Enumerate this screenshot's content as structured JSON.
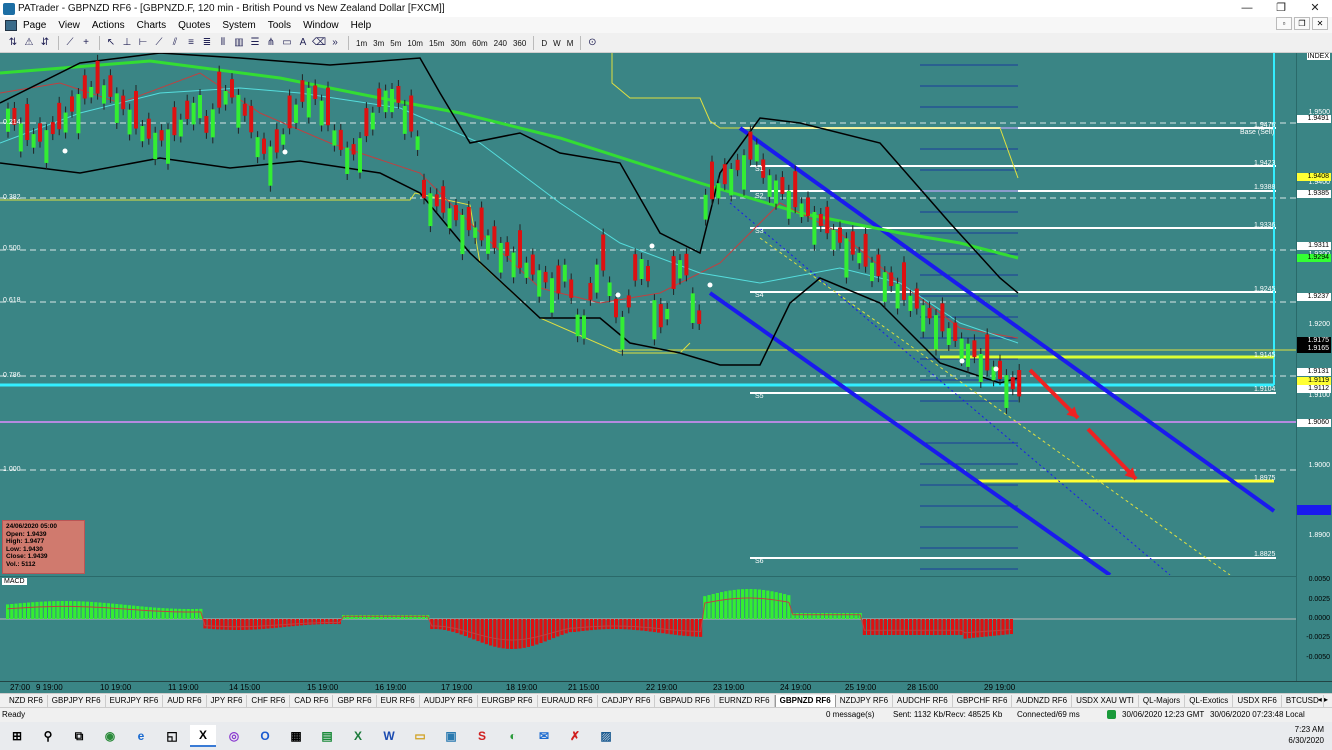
{
  "window": {
    "title": "PATrader - GBPNZD RF6 - [GBPNZD.F, 120 min - British Pound vs New Zealand Dollar [FXCM]]",
    "controls": [
      "—",
      "❐",
      "✕"
    ]
  },
  "menu": {
    "items": [
      "Page",
      "View",
      "Actions",
      "Charts",
      "Quotes",
      "System",
      "Tools",
      "Window",
      "Help"
    ],
    "mdi_controls": [
      "▫",
      "❐",
      "✕"
    ]
  },
  "toolbar": {
    "timeframes": [
      "1m",
      "3m",
      "5m",
      "10m",
      "15m",
      "30m",
      "60m",
      "240",
      "360"
    ],
    "periods": [
      "D",
      "W",
      "M"
    ]
  },
  "chart": {
    "symbol": "GBPNZD.F",
    "interval": "120 min",
    "index_label": "INDEX",
    "price_labels": [
      "1.9500",
      "1.9400",
      "1.9300",
      "1.9200",
      "1.9100",
      "1.9000",
      "1.8900",
      "1.8800"
    ],
    "price_tags": [
      {
        "text": "1.9491",
        "color": "#ffffff"
      },
      {
        "text": "1.9408",
        "color": "#ffff33"
      },
      {
        "text": "1.9385",
        "color": "#ffffff"
      },
      {
        "text": "1.9311",
        "color": "#ffffff"
      },
      {
        "text": "1.9294",
        "color": "#33ff33"
      },
      {
        "text": "1.9237",
        "color": "#ffffff"
      },
      {
        "text": "1.9175",
        "color": "#000000"
      },
      {
        "text": "1.9165",
        "color": "#000000"
      },
      {
        "text": "1.9131",
        "color": "#ffffff"
      },
      {
        "text": "1.9119",
        "color": "#ffff33"
      },
      {
        "text": "1.9112",
        "color": "#ffffff"
      },
      {
        "text": "1.9060",
        "color": "#ffffff"
      }
    ],
    "fib_levels": [
      "0.214",
      "0.382",
      "0.500",
      "0.618",
      "0.786",
      "1.000"
    ],
    "pivot_labels": [
      {
        "level": "1.9476",
        "tag": "Base (Sell)"
      },
      {
        "level": "1.9423",
        "tag": "S1"
      },
      {
        "level": "1.9388",
        "tag": "S2"
      },
      {
        "level": "1.9336",
        "tag": "S3"
      },
      {
        "level": "1.9245",
        "tag": "S4"
      },
      {
        "level": "1.9145",
        "tag": ""
      },
      {
        "level": "1.9104",
        "tag": "S5"
      },
      {
        "level": "1.8975",
        "tag": ""
      },
      {
        "level": "1.8825",
        "tag": "S6"
      }
    ],
    "ohlc_box": {
      "date": "24/06/2020 05:00",
      "open": "Open: 1.9439",
      "high": "High: 1.9477",
      "low": "Low: 1.9430",
      "close": "Close: 1.9439",
      "vol": "Vol.: 5112"
    },
    "macd_label": "MACD",
    "macd_scale": [
      "0.0050",
      "0.0025",
      "0.0000",
      "-0.0025",
      "-0.0050"
    ],
    "time_labels": [
      "27:00",
      "9 19:00",
      "10 19:00",
      "11 19:00",
      "14 15:00",
      "15 19:00",
      "16 19:00",
      "17 19:00",
      "18 19:00",
      "21 15:00",
      "22 19:00",
      "23 19:00",
      "24 19:00",
      "25 19:00",
      "28 15:00",
      "29 19:00"
    ],
    "colors": {
      "background": "#3a8585",
      "bull": "#33ee33",
      "bear": "#dd1111",
      "channel": "#1a1aee",
      "ma_green": "#33dd33"
    }
  },
  "symbol_tabs": [
    "NZD RF6",
    "GBPJPY RF6",
    "EURJPY RF6",
    "AUD RF6",
    "JPY RF6",
    "CHF RF6",
    "CAD RF6",
    "GBP RF6",
    "EUR RF6",
    "AUDJPY RF6",
    "EURGBP RF6",
    "EURAUD RF6",
    "CADJPY RF6",
    "GBPAUD RF6",
    "EURNZD RF6",
    "GBPNZD RF6",
    "NZDJPY RF6",
    "AUDCHF RF6",
    "GBPCHF RF6",
    "AUDNZD RF6",
    "USDX XAU WTI",
    "QL-Majors",
    "QL-Exotics",
    "USDX RF6",
    "BTCUSD"
  ],
  "active_tab": "GBPNZD RF6",
  "tab_nav": "◂ ▸",
  "status": {
    "ready": "Ready",
    "messages": "0 message(s)",
    "sent": "Sent: 1132 Kb/Recv: 48525 Kb",
    "connected": "Connected/69 ms",
    "gmt": "30/06/2020 12:23 GMT",
    "local": "30/06/2020 07:23:48 Local"
  },
  "taskbar": {
    "icons": [
      "windows-logo",
      "search",
      "task-view",
      "chrome",
      "edge",
      "files",
      "x-app",
      "browser",
      "outlook",
      "calculator",
      "store",
      "excel",
      "word",
      "folder",
      "explorer",
      "app-red",
      "app-green",
      "app-mail",
      "app-x",
      "app-blue"
    ],
    "glyphs": [
      "⊞",
      "⚲",
      "⧉",
      "◉",
      "e",
      "◱",
      "X",
      "◎",
      "O",
      "▦",
      "▤",
      "X",
      "W",
      "▭",
      "▣",
      "S",
      "◐",
      "✉",
      "✗",
      "▨"
    ],
    "time": "7:23 AM",
    "date": "6/30/2020"
  }
}
